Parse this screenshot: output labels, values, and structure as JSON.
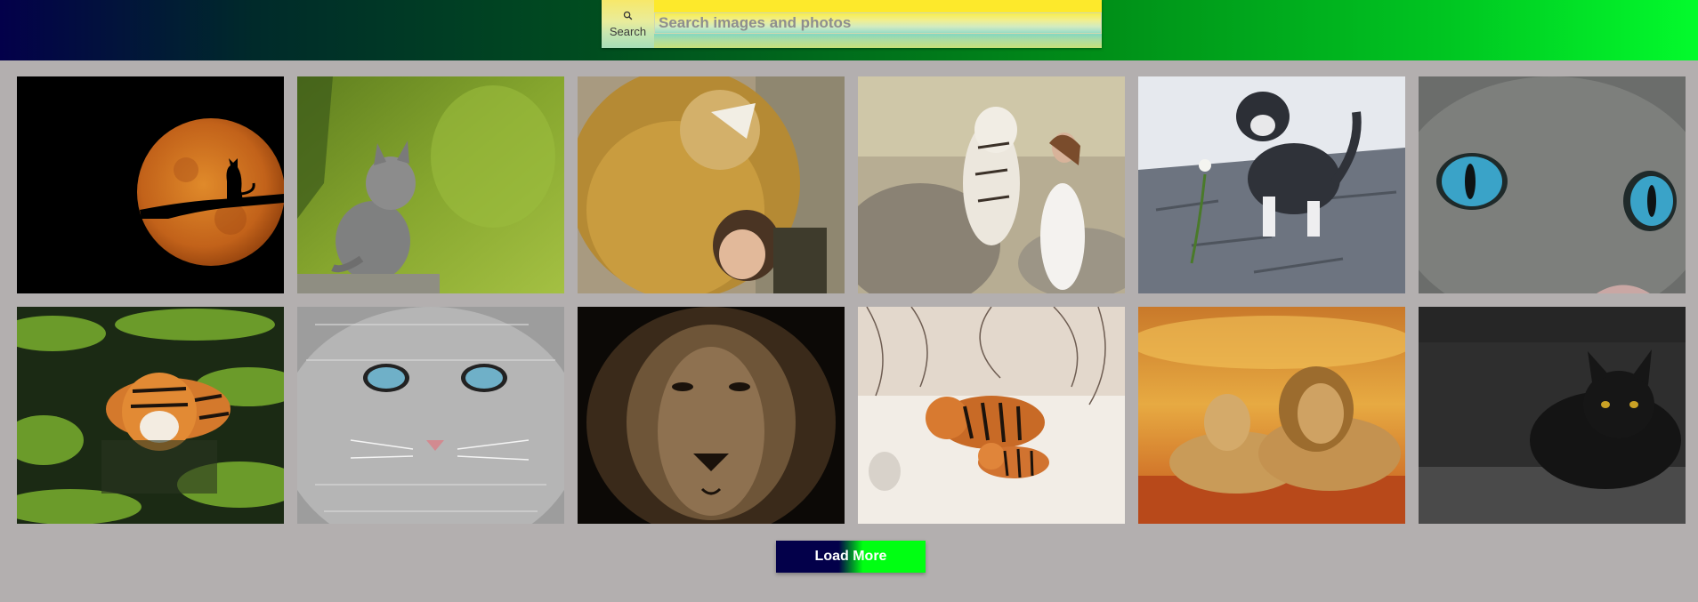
{
  "search": {
    "button_label": "Search",
    "placeholder": "Search images and photos",
    "icon": "search-icon"
  },
  "gallery": {
    "images": [
      {
        "subject": "cat-moon-silhouette"
      },
      {
        "subject": "gray-kitten-on-rock"
      },
      {
        "subject": "lion-and-girl"
      },
      {
        "subject": "white-tiger-and-woman"
      },
      {
        "subject": "kitten-with-flower"
      },
      {
        "subject": "cat-blue-eyes-closeup"
      },
      {
        "subject": "tiger-in-water"
      },
      {
        "subject": "gray-cat-blue-eyes"
      },
      {
        "subject": "lion-face-dark"
      },
      {
        "subject": "tigers-in-snow"
      },
      {
        "subject": "lion-couple-sunset"
      },
      {
        "subject": "black-cat"
      }
    ]
  },
  "actions": {
    "load_more_label": "Load More"
  },
  "colors": {
    "page_background": "#b3afaf",
    "header_start": "#03004a",
    "header_end": "#03fb2c",
    "search_yellow": "#fde92b",
    "load_more_dark": "#03004a",
    "load_more_green": "#00ff12"
  }
}
